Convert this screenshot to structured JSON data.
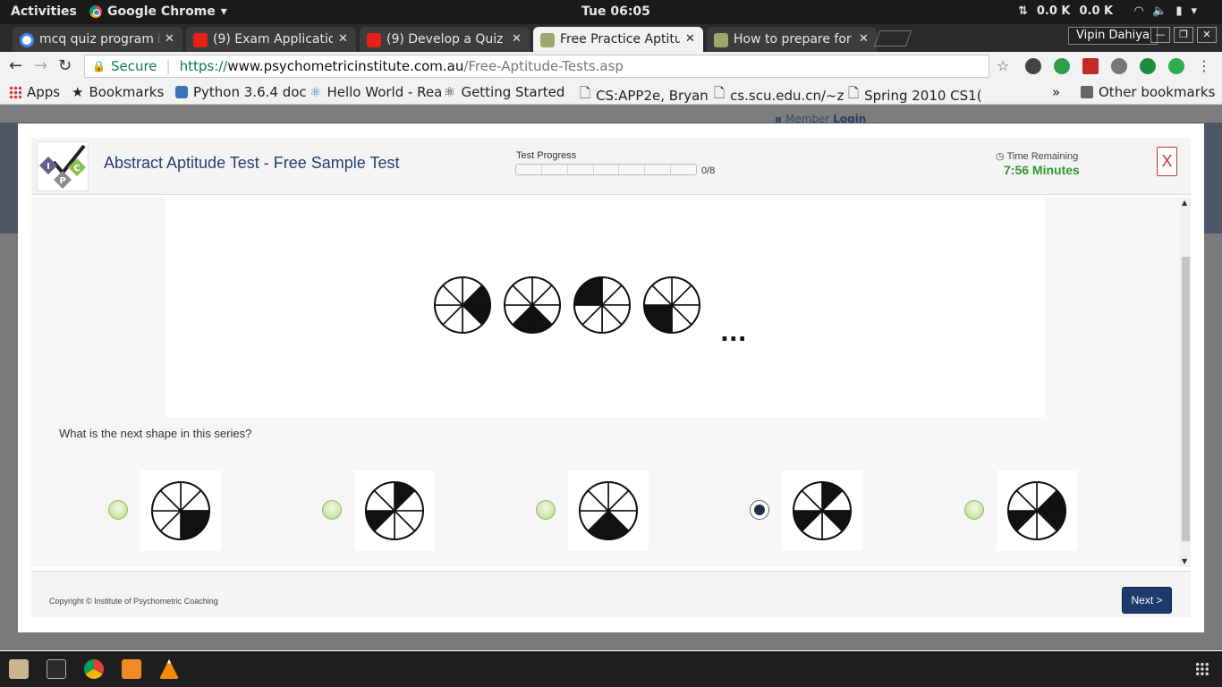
{
  "system": {
    "activities": "Activities",
    "app_name": "Google Chrome",
    "clock": "Tue 06:05",
    "net_up": "0.0 K",
    "net_down": "0.0 K"
  },
  "browser": {
    "tabs": [
      {
        "title": "mcq quiz program i",
        "icon": "google-icon"
      },
      {
        "title": "(9) Exam Applicatio",
        "icon": "youtube-icon"
      },
      {
        "title": "(9) Develop a Quiz A",
        "icon": "youtube-icon"
      },
      {
        "title": "Free Practice Aptitu",
        "icon": "site-icon",
        "active": true
      },
      {
        "title": "How to prepare for",
        "icon": "site-icon"
      }
    ],
    "profile_name": "Vipin Dahiya",
    "secure_label": "Secure",
    "url_protocol": "https://",
    "url_host": "www.psychometricinstitute.com.au",
    "url_path": "/Free-Aptitude-Tests.asp",
    "bookmarks": [
      {
        "label": "Apps"
      },
      {
        "label": "Bookmarks"
      },
      {
        "label": "Python 3.6.4 doc"
      },
      {
        "label": "Hello World - Rea"
      },
      {
        "label": "Getting Started"
      },
      {
        "label": "CS:APP2e, Bryan"
      },
      {
        "label": "cs.scu.edu.cn/~z"
      },
      {
        "label": "Spring 2010 CS1("
      }
    ],
    "bookmarks_overflow": "»",
    "other_bookmarks": "Other bookmarks"
  },
  "page": {
    "member_label": "Member",
    "login_label": "Login"
  },
  "modal": {
    "title": "Abstract Aptitude Test - Free Sample Test",
    "progress_label": "Test Progress",
    "progress_count": "0/8",
    "progress_fraction": 0,
    "time_label": "Time Remaining",
    "time_value": "7:56 Minutes",
    "close_label": "X",
    "question": "What is the next shape in this series?",
    "series_ellipsis": "...",
    "series": [
      {
        "filled": [
          1,
          2
        ]
      },
      {
        "filled": [
          3,
          4
        ]
      },
      {
        "filled": [
          6,
          7
        ]
      },
      {
        "filled": [
          4,
          5
        ]
      }
    ],
    "options": [
      {
        "filled": [
          2,
          3
        ],
        "selected": false
      },
      {
        "filled": [
          0,
          5
        ],
        "selected": false
      },
      {
        "filled": [
          3,
          4
        ],
        "selected": false
      },
      {
        "filled": [
          0,
          2,
          5
        ],
        "selected": true
      },
      {
        "filled": [
          1,
          2,
          5
        ],
        "selected": false
      }
    ],
    "copyright": "Copyright © Institute of Psychometric Coaching",
    "next_label": "Next >"
  },
  "colors": {
    "title": "#223f6f",
    "time": "#2c9a2c",
    "next_button": "#1c3a6b",
    "close": "#cc3333"
  }
}
